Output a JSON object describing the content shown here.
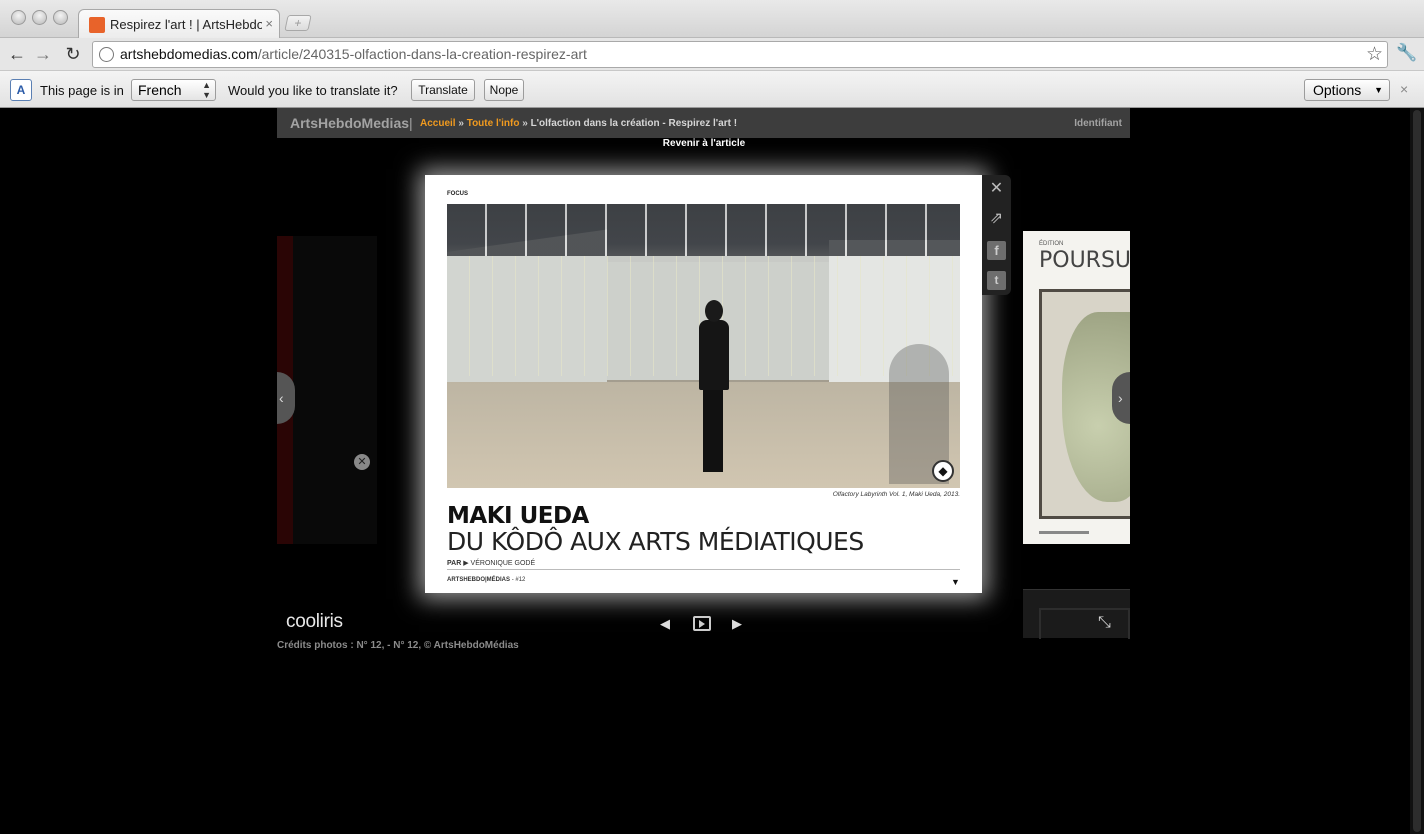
{
  "browser": {
    "tab": {
      "title": "Respirez l'art ! | ArtsHebdoM",
      "close": "×"
    },
    "new_tab": "+",
    "nav": {
      "back": "←",
      "forward": "→",
      "reload": "↻"
    },
    "address": {
      "host": "artshebdomedias.com",
      "path": "/article/240315-olfaction-dans-la-creation-respirez-art"
    },
    "star": "☆",
    "wrench": "🔧"
  },
  "infobar": {
    "icon": "A",
    "page_in": "This page is in",
    "language": "French",
    "question": "Would you like to translate it?",
    "translate": "Translate",
    "nope": "Nope",
    "options": "Options",
    "close": "×"
  },
  "site": {
    "brand": "ArtsHebdoMedias",
    "separator": "|",
    "crumb_home": "Accueil",
    "crumb_sep": "»",
    "crumb_all": "Toute l'info",
    "crumb_current": "L'olfaction dans la création - Respirez l'art !",
    "login": "Identifiant",
    "back_to_article": "Revenir à l'article"
  },
  "viewer": {
    "focus": "FOCUS",
    "caption": "Olfactory Labyrinth Vol. 1, Maki Ueda, 2013.",
    "title": "MAKI UEDA",
    "subtitle": "DU KÔDÔ AUX ARTS MÉDIATIQUES",
    "by_label": "PAR",
    "author": "VÉRONIQUE GODÉ",
    "footer_brand": "ARTSHEBDO|MÉDIAS",
    "footer_issue": "- #12"
  },
  "right_preview": {
    "small": "ÉDITION",
    "big": "POURSUIV"
  },
  "controls": {
    "prev": "◀",
    "next": "▶",
    "brand": "cooliris"
  },
  "credits": "Crédits photos : N° 12, - N° 12, © ArtsHebdoMédias"
}
